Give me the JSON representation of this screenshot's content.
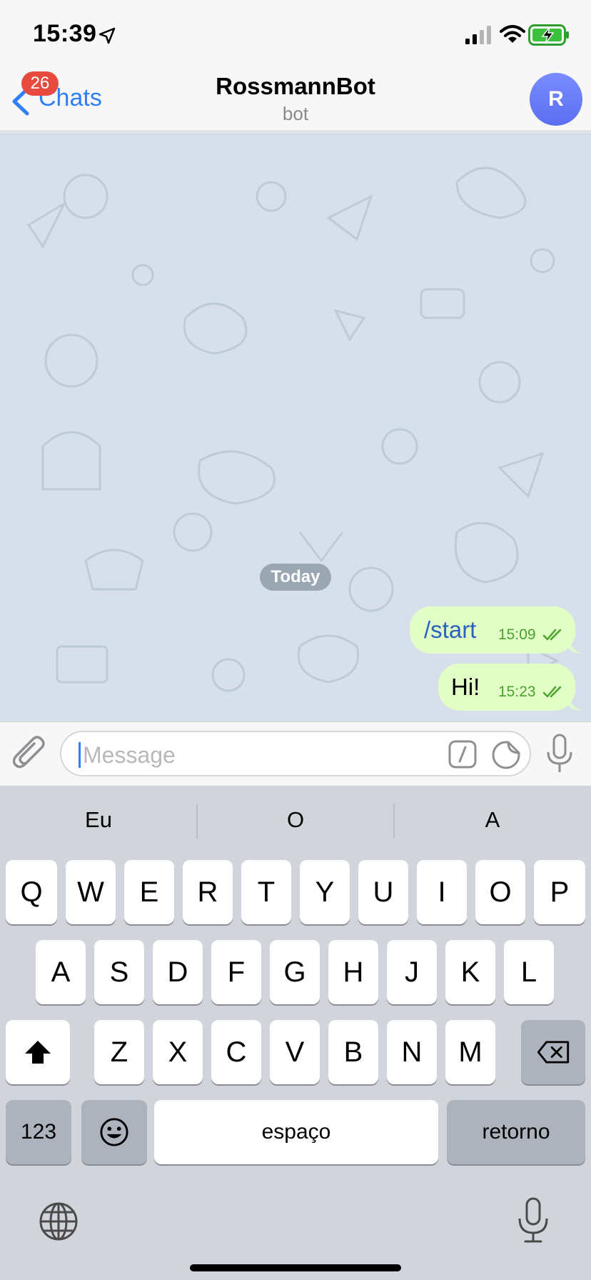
{
  "status_bar": {
    "time": "15:39"
  },
  "nav": {
    "back_label": "Chats",
    "unread_badge": "26",
    "title": "RossmannBot",
    "subtitle": "bot",
    "avatar_letter": "R"
  },
  "chat": {
    "date_separator": "Today",
    "messages": [
      {
        "text": "/start",
        "time": "15:09",
        "status": "read"
      },
      {
        "text": "Hi!",
        "time": "15:23",
        "status": "read"
      }
    ]
  },
  "input": {
    "placeholder": "Message",
    "value": ""
  },
  "keyboard": {
    "suggestions": [
      "Eu",
      "O",
      "A"
    ],
    "row1": [
      "Q",
      "W",
      "E",
      "R",
      "T",
      "Y",
      "U",
      "I",
      "O",
      "P"
    ],
    "row2": [
      "A",
      "S",
      "D",
      "F",
      "G",
      "H",
      "J",
      "K",
      "L"
    ],
    "row3": [
      "Z",
      "X",
      "C",
      "V",
      "B",
      "N",
      "M"
    ],
    "numbers_label": "123",
    "space_label": "espaço",
    "return_label": "retorno"
  },
  "colors": {
    "accent": "#2f7ff7",
    "badge": "#e94a3f",
    "outgoing_bubble": "#e1fec6",
    "timestamp_green": "#4ba22d",
    "chat_background": "#d7dfea"
  }
}
